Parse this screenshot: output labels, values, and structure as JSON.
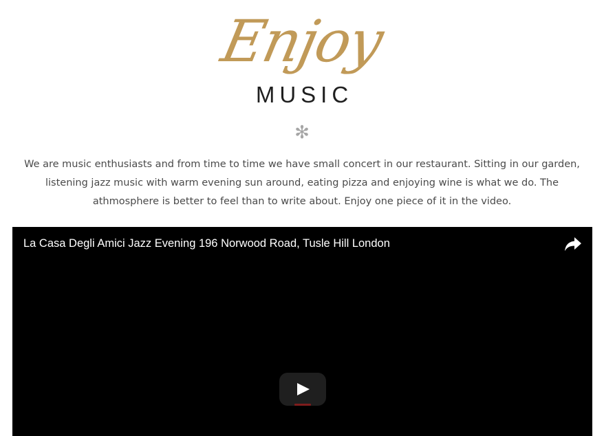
{
  "heading": {
    "script_word": "Enjoy",
    "caps_word": "MUSIC",
    "divider": "✻"
  },
  "intro": {
    "text": "We are music enthusiasts and from time to time we have small concert in our restaurant. Sitting in our garden, listening jazz music with warm evening sun around, eating pizza and enjoying wine is what we do. The athmosphere is better to feel than to write about. Enjoy one piece of it in the video."
  },
  "video": {
    "title": "La Casa Degli Amici Jazz Evening 196 Norwood Road, Tusle Hill London",
    "share_icon": "share-icon",
    "play_icon": "play-icon"
  },
  "colors": {
    "accent_gold": "#c19a58",
    "heading_dark": "#1f1f1f",
    "body_text": "#4a4a4a",
    "divider_gray": "#a6a6a6",
    "video_bg": "#000000"
  }
}
